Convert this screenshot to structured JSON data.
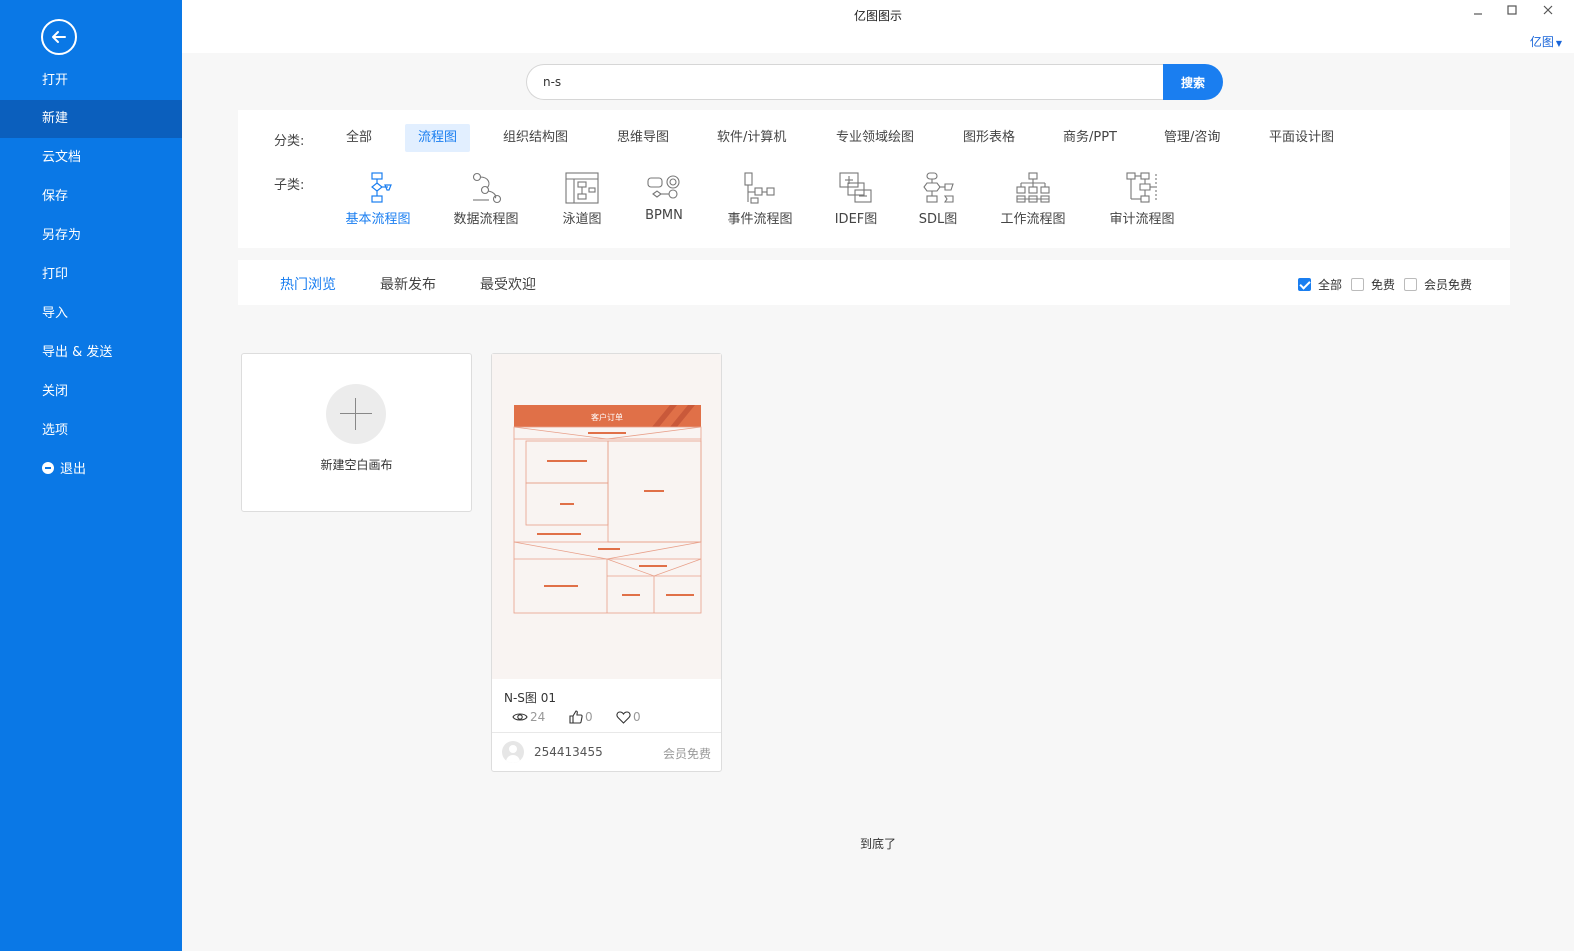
{
  "app": {
    "title": "亿图图示",
    "brand_menu": "亿图"
  },
  "sidebar": {
    "items": [
      {
        "label": "打开"
      },
      {
        "label": "新建"
      },
      {
        "label": "云文档"
      },
      {
        "label": "保存"
      },
      {
        "label": "另存为"
      },
      {
        "label": "打印"
      },
      {
        "label": "导入"
      },
      {
        "label": "导出 & 发送"
      },
      {
        "label": "关闭"
      },
      {
        "label": "选项"
      },
      {
        "label": "退出"
      }
    ],
    "active_item": "新建"
  },
  "search": {
    "value": "n-s",
    "button_label": "搜索"
  },
  "categories": {
    "label": "分类:",
    "items": [
      {
        "label": "全部"
      },
      {
        "label": "流程图"
      },
      {
        "label": "组织结构图"
      },
      {
        "label": "思维导图"
      },
      {
        "label": "软件/计算机"
      },
      {
        "label": "专业领域绘图"
      },
      {
        "label": "图形表格"
      },
      {
        "label": "商务/PPT"
      },
      {
        "label": "管理/咨询"
      },
      {
        "label": "平面设计图"
      }
    ],
    "active": "流程图"
  },
  "subcategories": {
    "label": "子类:",
    "items": [
      {
        "label": "基本流程图",
        "icon": "basic-flowchart-icon"
      },
      {
        "label": "数据流程图",
        "icon": "data-flow-icon"
      },
      {
        "label": "泳道图",
        "icon": "swimlane-icon"
      },
      {
        "label": "BPMN",
        "icon": "bpmn-icon"
      },
      {
        "label": "事件流程图",
        "icon": "event-flow-icon"
      },
      {
        "label": "IDEF图",
        "icon": "idef-icon"
      },
      {
        "label": "SDL图",
        "icon": "sdl-icon"
      },
      {
        "label": "工作流程图",
        "icon": "workflow-icon"
      },
      {
        "label": "审计流程图",
        "icon": "audit-flow-icon"
      }
    ],
    "active": "基本流程图"
  },
  "sort": {
    "tabs": [
      {
        "label": "热门浏览"
      },
      {
        "label": "最新发布"
      },
      {
        "label": "最受欢迎"
      }
    ],
    "active": "热门浏览"
  },
  "filters": [
    {
      "label": "全部",
      "checked": true
    },
    {
      "label": "免费",
      "checked": false
    },
    {
      "label": "会员免费",
      "checked": false
    }
  ],
  "new_canvas": {
    "label": "新建空白画布"
  },
  "template": {
    "name": "N-S图 01",
    "views": "24",
    "likes": "0",
    "favorites": "0",
    "author": "254413455",
    "price": "会员免费",
    "thumbnail_title": "客户订单"
  },
  "footer": {
    "end_text": "到底了"
  },
  "colors": {
    "sidebar": "#0a78e6",
    "sidebar_active": "#0b5fbd",
    "accent": "#1a7ef0",
    "thumb_header": "#e07048"
  }
}
